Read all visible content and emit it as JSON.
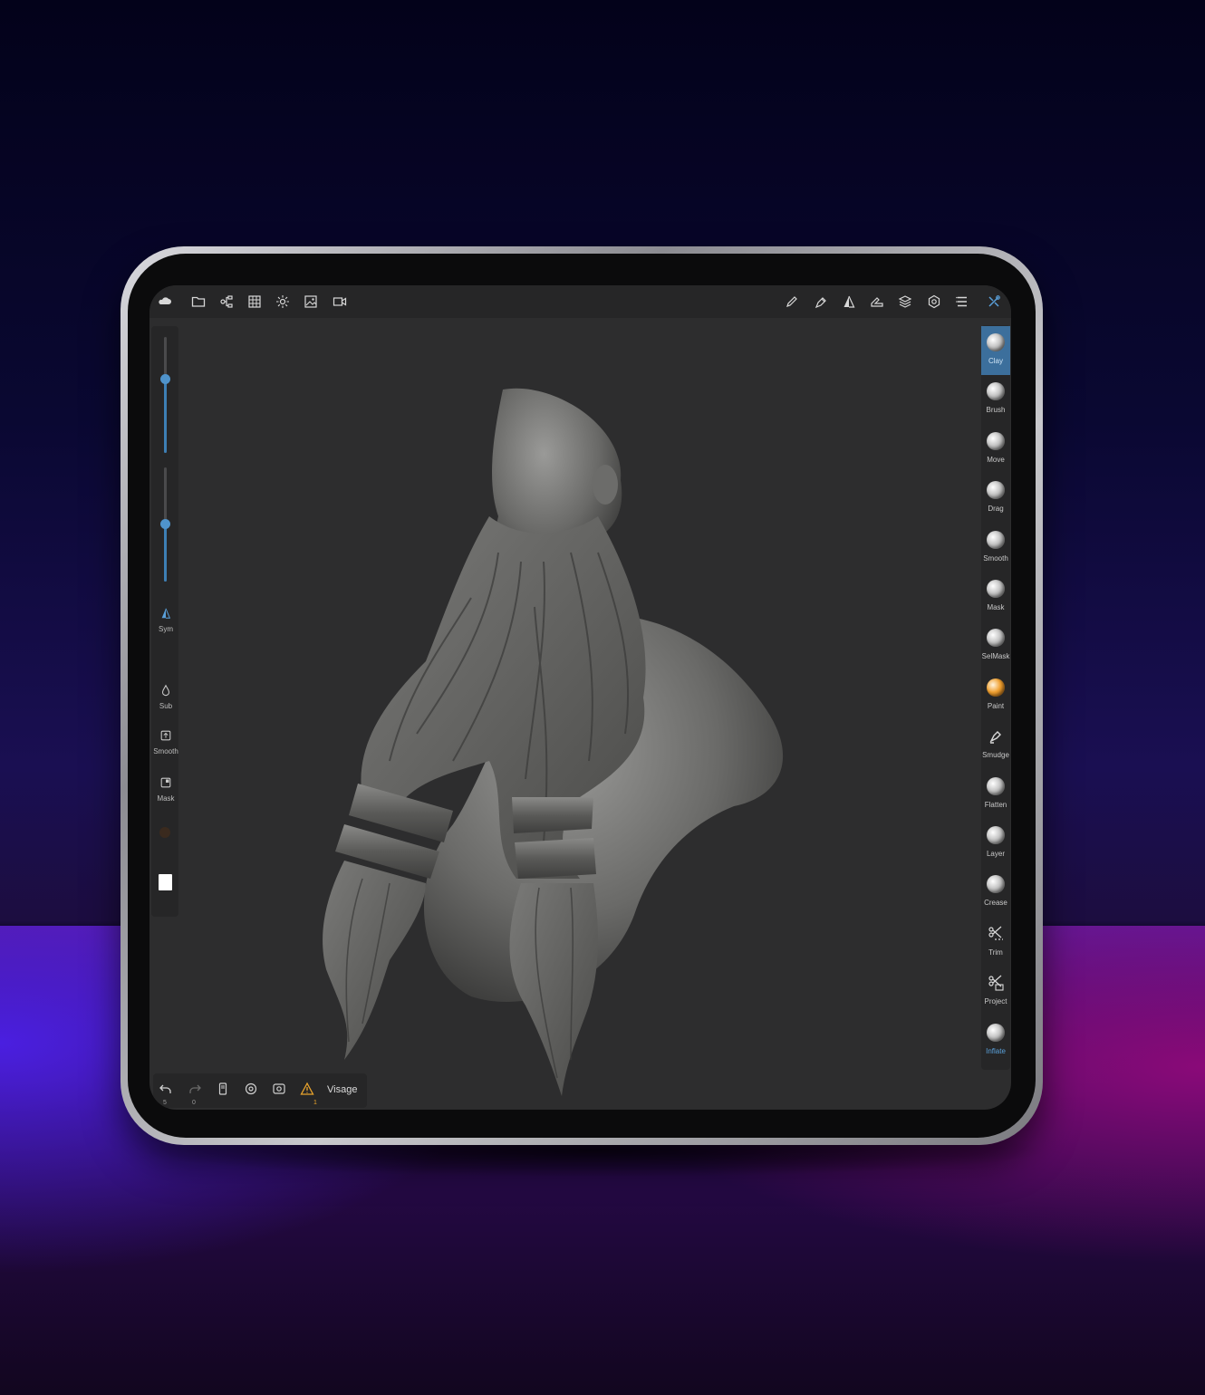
{
  "topbar": {
    "left_icons": [
      "cloud-icon",
      "folder-icon",
      "scene-tree-icon",
      "grid-icon",
      "light-icon",
      "image-icon",
      "video-icon"
    ],
    "right_icons": [
      "pencil-icon",
      "pen-icon",
      "symmetry-icon",
      "transform-icon",
      "layers-icon",
      "settings-icon",
      "menu-icon",
      "tools-icon"
    ]
  },
  "left_panel": {
    "radius_slider": 0.6,
    "intensity_slider": 0.5,
    "sym_label": "Sym",
    "sub_label": "Sub",
    "smooth_label": "Smooth",
    "mask_label": "Mask"
  },
  "tools": [
    {
      "label": "Clay",
      "icon": "sphere",
      "active": true
    },
    {
      "label": "Brush",
      "icon": "sphere"
    },
    {
      "label": "Move",
      "icon": "sphere"
    },
    {
      "label": "Drag",
      "icon": "sphere"
    },
    {
      "label": "Smooth",
      "icon": "sphere"
    },
    {
      "label": "Mask",
      "icon": "sphere"
    },
    {
      "label": "SelMask",
      "icon": "sphere"
    },
    {
      "label": "Paint",
      "icon": "paint"
    },
    {
      "label": "Smudge",
      "icon": "smudge"
    },
    {
      "label": "Flatten",
      "icon": "sphere"
    },
    {
      "label": "Layer",
      "icon": "sphere"
    },
    {
      "label": "Crease",
      "icon": "sphere"
    },
    {
      "label": "Trim",
      "icon": "trim"
    },
    {
      "label": "Project",
      "icon": "project"
    },
    {
      "label": "Inflate",
      "icon": "sphere"
    }
  ],
  "bottombar": {
    "undo_count": "5",
    "redo_count": "0",
    "warning_count": "1",
    "object_name": "Visage"
  },
  "colors": {
    "accent": "#3d7fb5",
    "active_tool_bg": "#3c6f9c",
    "warning": "#e8a32c",
    "paint": "#f0a030"
  }
}
